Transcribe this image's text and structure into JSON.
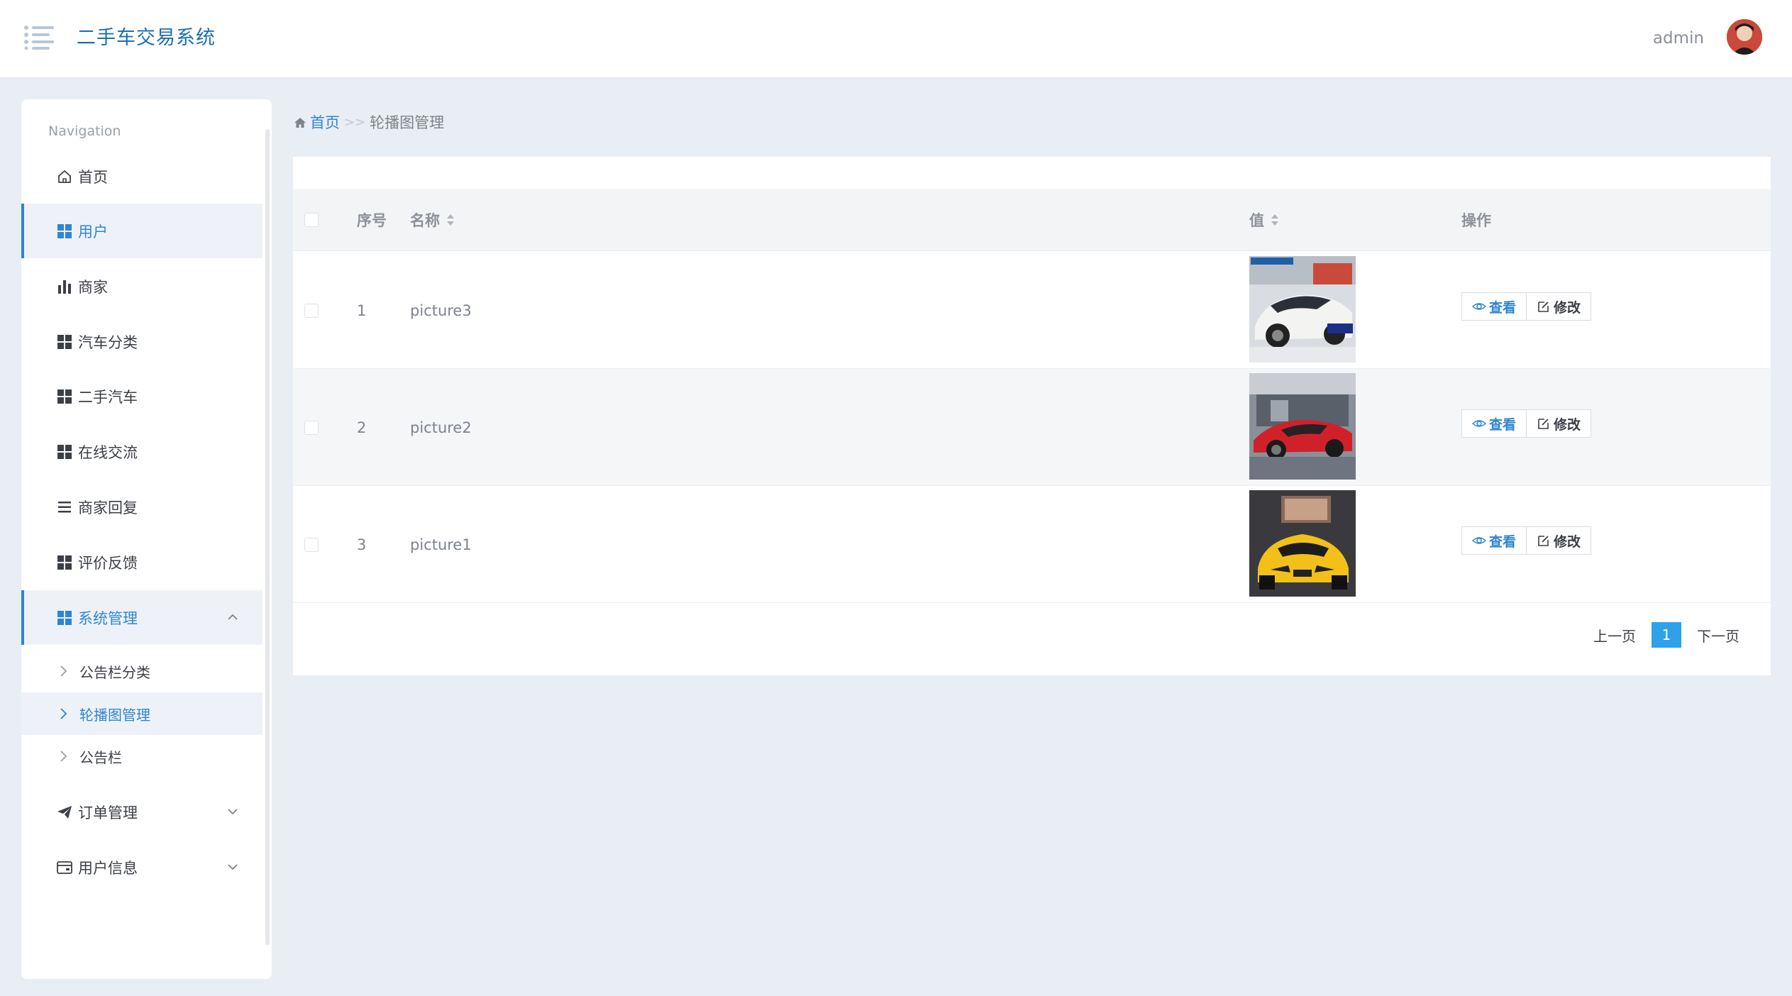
{
  "app": {
    "title": "二手车交易系统"
  },
  "user": {
    "name": "admin"
  },
  "sidebar": {
    "heading": "Navigation",
    "items": [
      {
        "label": "首页",
        "icon": "home-icon"
      },
      {
        "label": "用户",
        "icon": "grid-icon",
        "active": true
      },
      {
        "label": "商家",
        "icon": "bar-chart-icon"
      },
      {
        "label": "汽车分类",
        "icon": "grid-icon"
      },
      {
        "label": "二手汽车",
        "icon": "grid-icon"
      },
      {
        "label": "在线交流",
        "icon": "grid-icon"
      },
      {
        "label": "商家回复",
        "icon": "list-icon"
      },
      {
        "label": "评价反馈",
        "icon": "grid-icon"
      },
      {
        "label": "系统管理",
        "icon": "grid-icon",
        "expanded": true
      },
      {
        "label": "订单管理",
        "icon": "paper-plane-icon"
      },
      {
        "label": "用户信息",
        "icon": "wallet-icon"
      }
    ],
    "subitems": [
      {
        "label": "公告栏分类"
      },
      {
        "label": "轮播图管理",
        "active": true
      },
      {
        "label": "公告栏"
      }
    ]
  },
  "breadcrumb": {
    "home": "首页",
    "separator": ">>",
    "current": "轮播图管理"
  },
  "table": {
    "columns": {
      "index": "序号",
      "name": "名称",
      "value": "值",
      "actions": "操作"
    },
    "rows": [
      {
        "index": "1",
        "name": "picture3",
        "image": "white-sports-car"
      },
      {
        "index": "2",
        "name": "picture2",
        "image": "red-sports-car"
      },
      {
        "index": "3",
        "name": "picture1",
        "image": "yellow-sports-car"
      }
    ],
    "view_label": "查看",
    "edit_label": "修改"
  },
  "pagination": {
    "prev": "上一页",
    "current": "1",
    "next": "下一页"
  },
  "colors": {
    "accent": "#2e86d1",
    "page_active": "#2ea1e8",
    "title": "#1d6fb2"
  }
}
